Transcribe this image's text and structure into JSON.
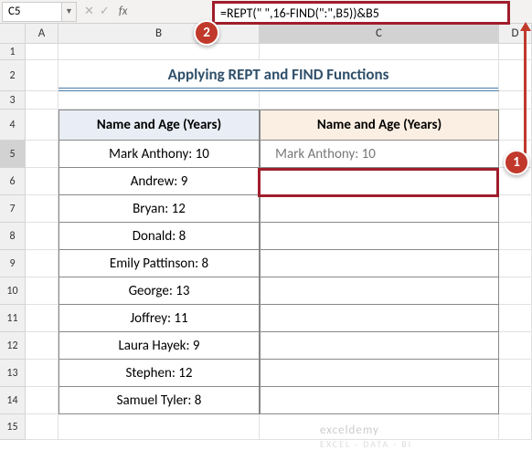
{
  "namebox": {
    "ref": "C5"
  },
  "formula": "=REPT(\" \",16-FIND(\":\",B5))&B5",
  "callouts": {
    "c1": "1",
    "c2": "2"
  },
  "cols": [
    "A",
    "B",
    "C",
    "D"
  ],
  "rows": [
    "1",
    "2",
    "3",
    "4",
    "5",
    "6",
    "7",
    "8",
    "9",
    "10",
    "11",
    "12",
    "13",
    "14",
    "15"
  ],
  "title": "Applying REPT and FIND Functions",
  "headers": {
    "b": "Name and Age (Years)",
    "c": "Name and Age (Years)"
  },
  "data": [
    {
      "b": "Mark Anthony: 10",
      "c": "   Mark Anthony: 10"
    },
    {
      "b": "Andrew: 9",
      "c": ""
    },
    {
      "b": "Bryan: 12",
      "c": ""
    },
    {
      "b": "Donald: 8",
      "c": ""
    },
    {
      "b": "Emily Pattinson: 8",
      "c": ""
    },
    {
      "b": "George: 13",
      "c": ""
    },
    {
      "b": "Joffrey: 11",
      "c": ""
    },
    {
      "b": "Laura Hayek: 9",
      "c": ""
    },
    {
      "b": "Stephen: 12",
      "c": ""
    },
    {
      "b": "Samuel Tyler: 8",
      "c": ""
    }
  ],
  "watermark": {
    "line1": "exceldemy",
    "line2": "EXCEL · DATA · BI"
  }
}
